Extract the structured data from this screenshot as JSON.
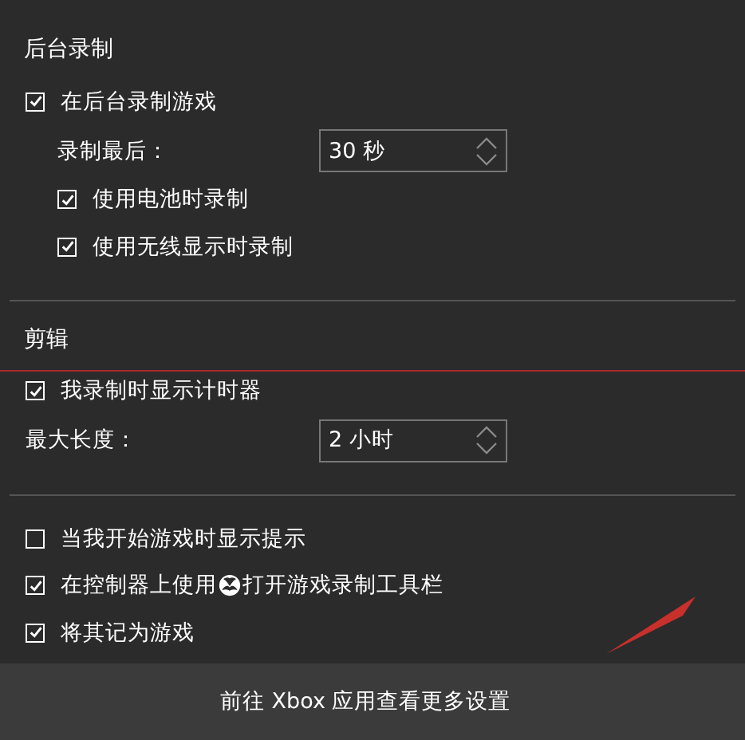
{
  "sections": [
    {
      "heading": "后台录制",
      "items": [
        {
          "kind": "checkbox",
          "label": "在后台录制游戏",
          "checked": true,
          "children": [
            {
              "kind": "spinner",
              "label": "录制最后：",
              "value": "30 秒"
            },
            {
              "kind": "checkbox",
              "label": "使用电池时录制",
              "checked": true
            },
            {
              "kind": "checkbox",
              "label": "使用无线显示时录制",
              "checked": true
            }
          ]
        }
      ]
    },
    {
      "heading": "剪辑",
      "items": [
        {
          "kind": "checkbox",
          "label": "我录制时显示计时器",
          "checked": true
        },
        {
          "kind": "spinner",
          "label": "最大长度：",
          "value": "2 小时"
        }
      ]
    },
    {
      "items": [
        {
          "kind": "checkbox",
          "label": "当我开始游戏时显示提示",
          "checked": false
        },
        {
          "kind": "checkbox",
          "label": "在控制器上使用",
          "label_after": "打开游戏录制工具栏",
          "checked": true
        },
        {
          "kind": "checkbox",
          "label": "将其记为游戏",
          "checked": true
        }
      ]
    }
  ],
  "footer": {
    "link": "前往 Xbox 应用查看更多设置"
  }
}
